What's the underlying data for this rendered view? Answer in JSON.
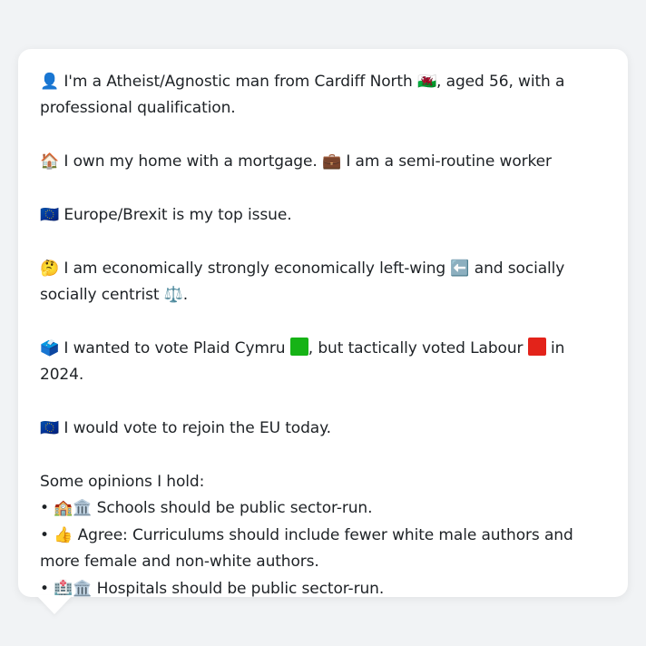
{
  "profile": {
    "line1": "👤 I'm a Atheist/Agnostic man from Cardiff North 🏴󠁧󠁢󠁷󠁬󠁳󠁿, aged 56, with a professional qualification.",
    "line2": "🏠 I own my home with a mortgage. 💼 I am a semi-routine worker",
    "line3": "🇪🇺 Europe/Brexit is my top issue.",
    "line4": "🤔 I am economically strongly economically left-wing ⬅️ and socially socially centrist ⚖️.",
    "line5_prefix": "🗳️ I wanted to vote Plaid Cymru ",
    "line5_middle": ", but tactically voted Labour ",
    "line5_suffix": " in 2024.",
    "line6": "🇪🇺 I would vote to rejoin the EU today.",
    "opinions_heading": "Some opinions I hold:",
    "opinions": [
      "• 🏫🏛️ Schools should be public sector-run.",
      "• 👍 Agree: Curriculums should include fewer white male authors and more female and non-white authors.",
      "• 🏥🏛️ Hospitals should be public sector-run."
    ]
  },
  "colors": {
    "plaid_square": "#16b316",
    "labour_square": "#e3231a",
    "bubble_bg": "#ffffff",
    "page_bg": "#f1f3f5"
  }
}
